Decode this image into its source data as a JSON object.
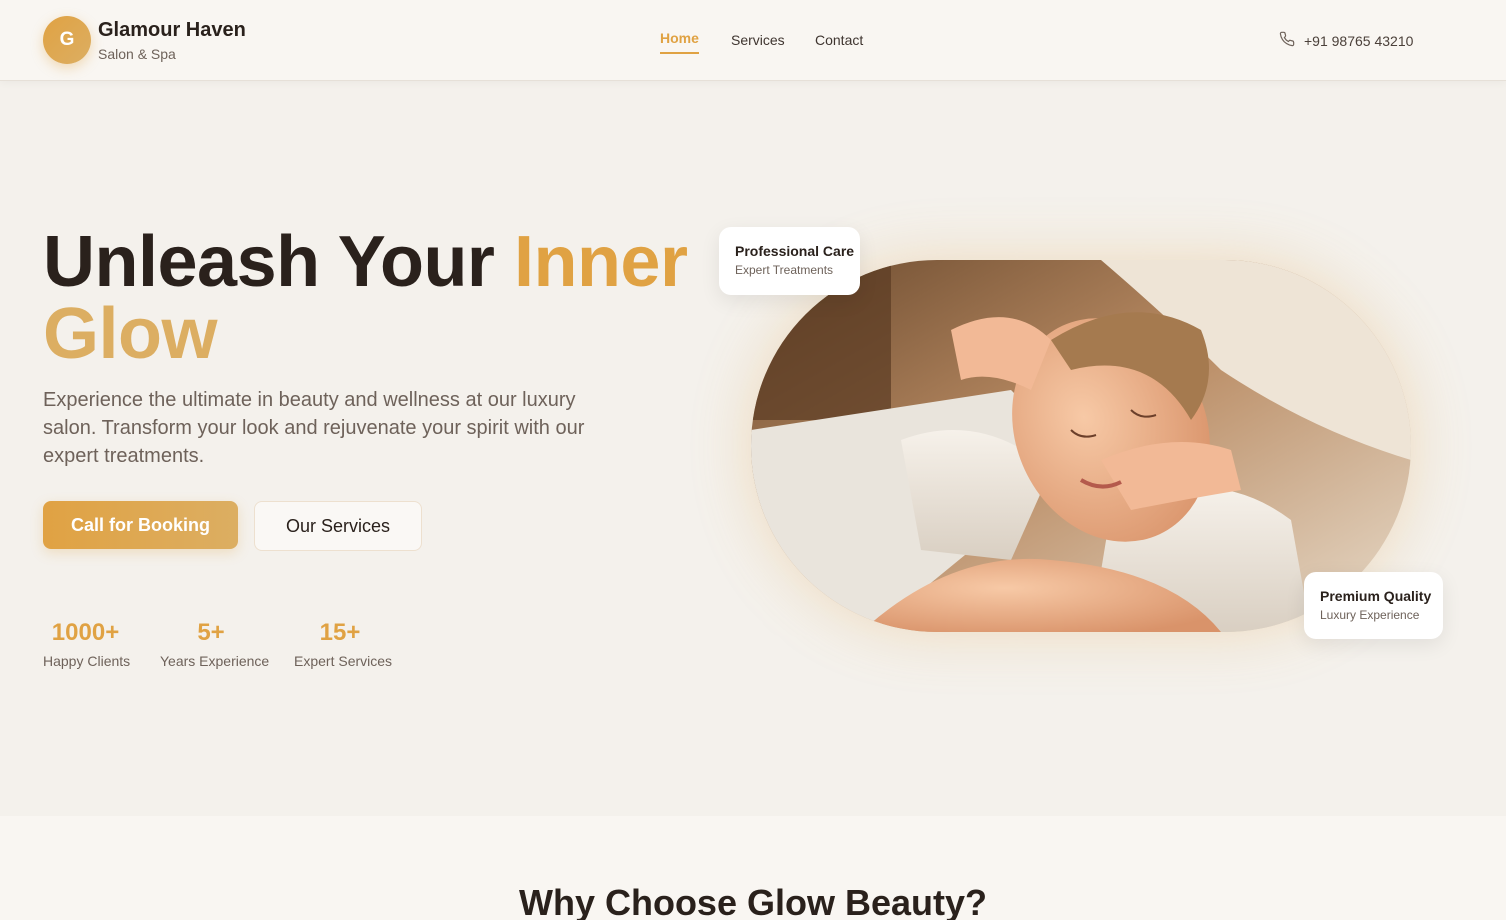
{
  "brand": {
    "logo_letter": "G",
    "name": "Glamour Haven",
    "subtitle": "Salon & Spa"
  },
  "nav": {
    "items": [
      {
        "label": "Home",
        "active": true
      },
      {
        "label": "Services",
        "active": false
      },
      {
        "label": "Contact",
        "active": false
      }
    ]
  },
  "contact": {
    "phone_icon": "phone-icon",
    "phone": "+91 98765 43210"
  },
  "hero": {
    "title_part1": "Unleash Your ",
    "title_accent": "Inner",
    "title_accent2": "Glow",
    "description": "Experience the ultimate in beauty and wellness at our luxury salon. Transform your look and rejuvenate your spirit with our expert treatments.",
    "primary_button": "Call for Booking",
    "secondary_button": "Our Services"
  },
  "stats": [
    {
      "value": "1000+",
      "label": "Happy Clients"
    },
    {
      "value": "5+",
      "label": "Years Experience"
    },
    {
      "value": "15+",
      "label": "Expert Services"
    }
  ],
  "badges": {
    "top": {
      "title": "Professional Care",
      "subtitle": "Expert Treatments"
    },
    "bottom": {
      "title": "Premium Quality",
      "subtitle": "Luxury Experience"
    }
  },
  "next_section": {
    "title": "Why Choose Glow Beauty?"
  },
  "colors": {
    "accent": "#e0a243",
    "accent_light": "#dcae62",
    "background": "#f4f1ec",
    "text_dark": "#2a211c",
    "text_muted": "#6e625a"
  }
}
